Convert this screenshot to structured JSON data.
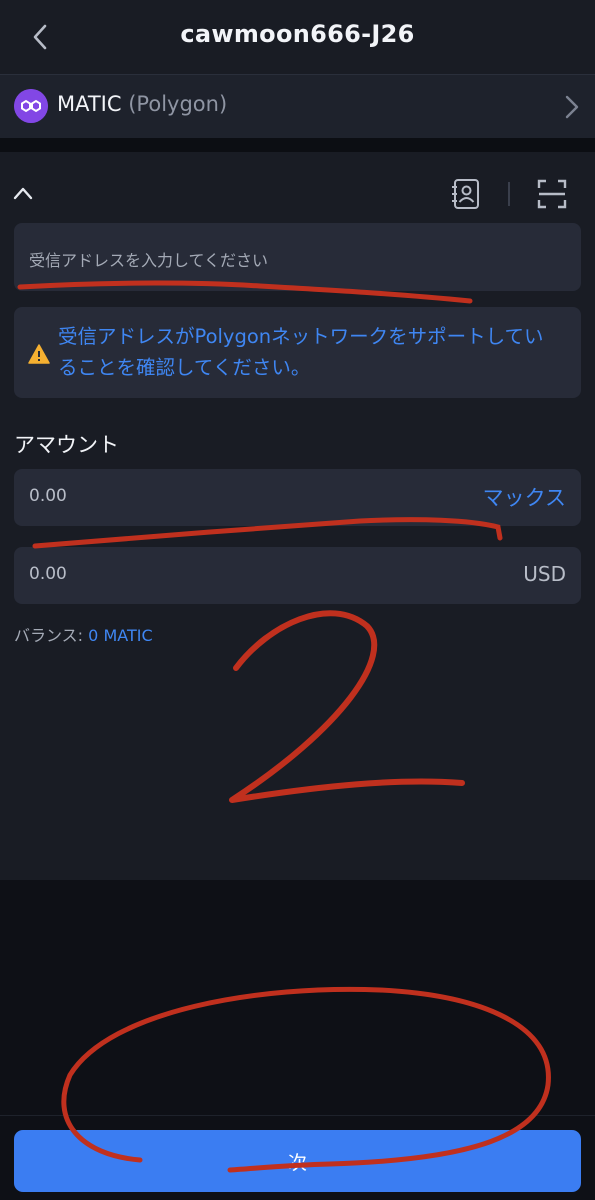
{
  "header": {
    "title": "cawmoon666-J26",
    "back_icon": "chevron-left-icon"
  },
  "network_selector": {
    "coin": "MATIC",
    "network": "(Polygon)",
    "logo_icon": "polygon-logo-icon",
    "chevron_icon": "chevron-right-icon",
    "logo_color": "#8247e5"
  },
  "recipient": {
    "collapse_icon": "chevron-up-icon",
    "contacts_icon": "address-book-icon",
    "scan_icon": "scan-icon",
    "placeholder": "受信アドレスを入力してください",
    "warning": "受信アドレスがPolygonネットワークをサポートしていることを確認してください。",
    "warning_icon": "warning-triangle-icon"
  },
  "amount": {
    "label": "アマウント",
    "value": "0.00",
    "max_label": "マックス",
    "fiat_value": "0.00",
    "fiat_currency": "USD"
  },
  "balance": {
    "label": "バランス:",
    "value": "0 MATIC"
  },
  "footer": {
    "next_label": "次"
  },
  "annotations": {
    "number": "2",
    "color": "#c0301e"
  },
  "colors": {
    "accent": "#3b7df2",
    "link": "#3f86f2",
    "warning": "#f5b031"
  }
}
